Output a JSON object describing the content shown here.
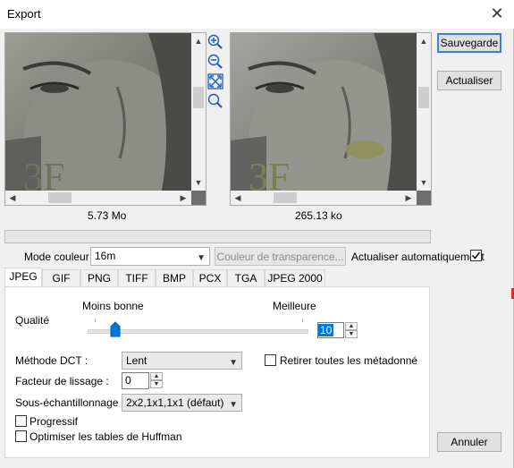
{
  "window": {
    "title": "Export",
    "close_glyph": "✕"
  },
  "preview_left": {
    "size": "5.73 Mo"
  },
  "preview_right": {
    "size": "265.13 ko"
  },
  "zoom_tools": [
    "zoom-in-icon",
    "zoom-out-icon",
    "fit-icon",
    "magnifier-icon"
  ],
  "buttons": {
    "save": "Sauvegarde",
    "refresh": "Actualiser",
    "cancel": "Annuler"
  },
  "progress": {
    "fraction": 0
  },
  "color_mode": {
    "label": "Mode couleur :",
    "value": "16m"
  },
  "transparency_button": "Couleur de transparence...",
  "auto_refresh": {
    "label": "Actualiser automatiquement",
    "checked": true
  },
  "tabs": [
    "JPEG",
    "GIF",
    "PNG",
    "TIFF",
    "BMP",
    "PCX",
    "TGA",
    "JPEG 2000"
  ],
  "active_tab": "JPEG",
  "jpeg": {
    "quality_label": "Qualité",
    "low_label": "Moins bonne",
    "high_label": "Meilleure",
    "quality_value": "10",
    "quality_fraction": 0.1,
    "dct_label": "Méthode DCT :",
    "dct_value": "Lent",
    "strip_metadata_label": "Retirer toutes les métadonné",
    "smoothing_label": "Facteur de lissage :",
    "smoothing_value": "0",
    "subsampling_label": "Sous-échantillonnage :",
    "subsampling_value": "2x2,1x1,1x1 (défaut)",
    "progressive_label": "Progressif",
    "optimize_label": "Optimiser les tables de Huffman"
  }
}
